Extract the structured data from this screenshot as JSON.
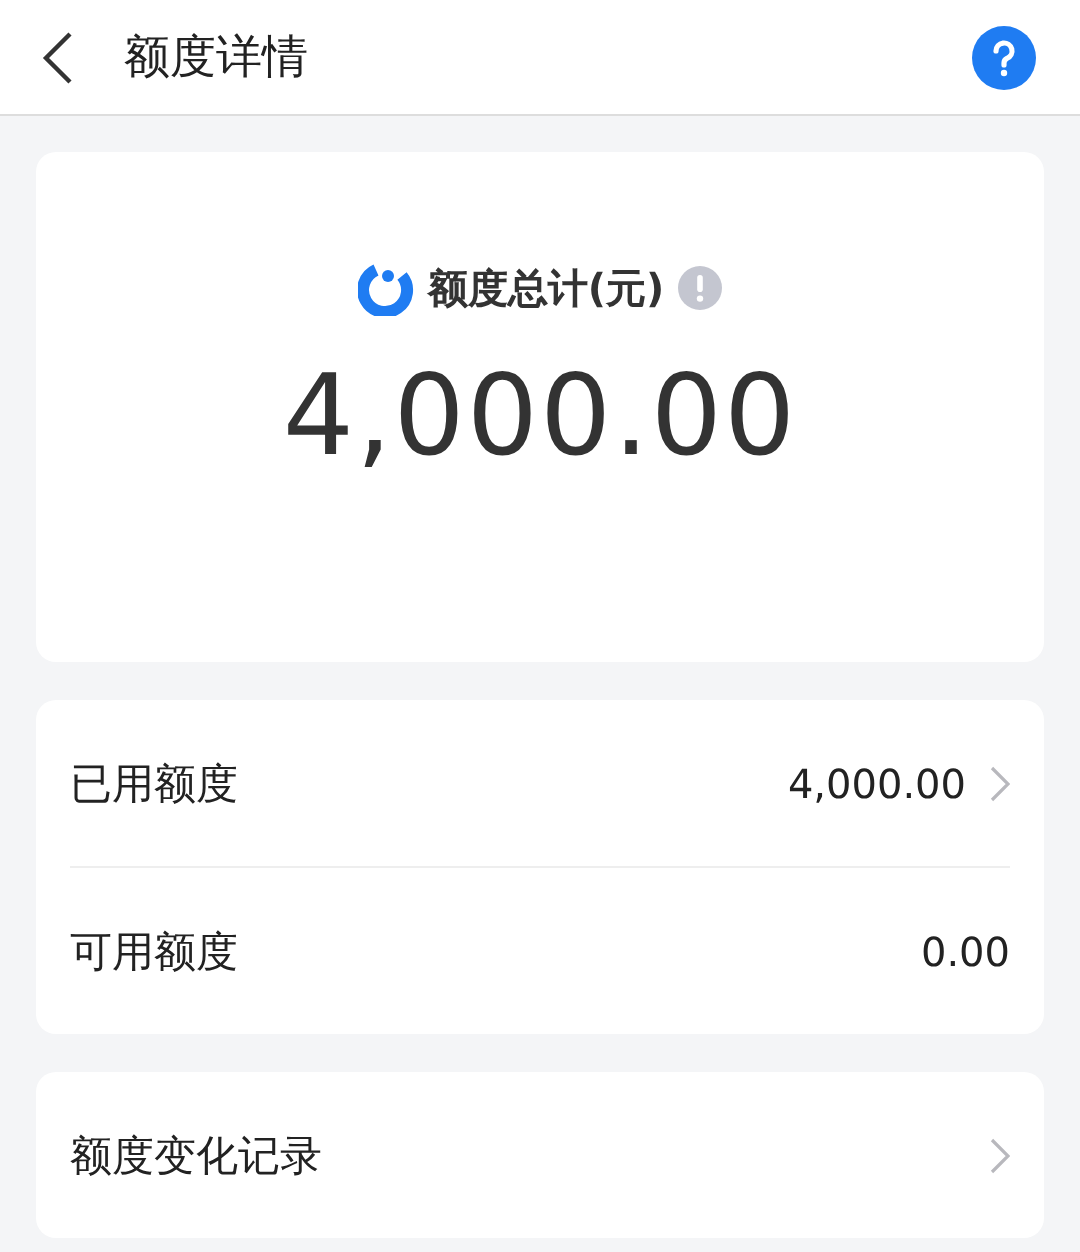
{
  "header": {
    "title": "额度详情"
  },
  "summary": {
    "label": "额度总计(元)",
    "amount": "4,000.00"
  },
  "details": [
    {
      "label": "已用额度",
      "value": "4,000.00",
      "has_arrow": true
    },
    {
      "label": "可用额度",
      "value": "0.00",
      "has_arrow": false
    }
  ],
  "records": [
    {
      "label": "额度变化记录",
      "has_arrow": true
    }
  ]
}
